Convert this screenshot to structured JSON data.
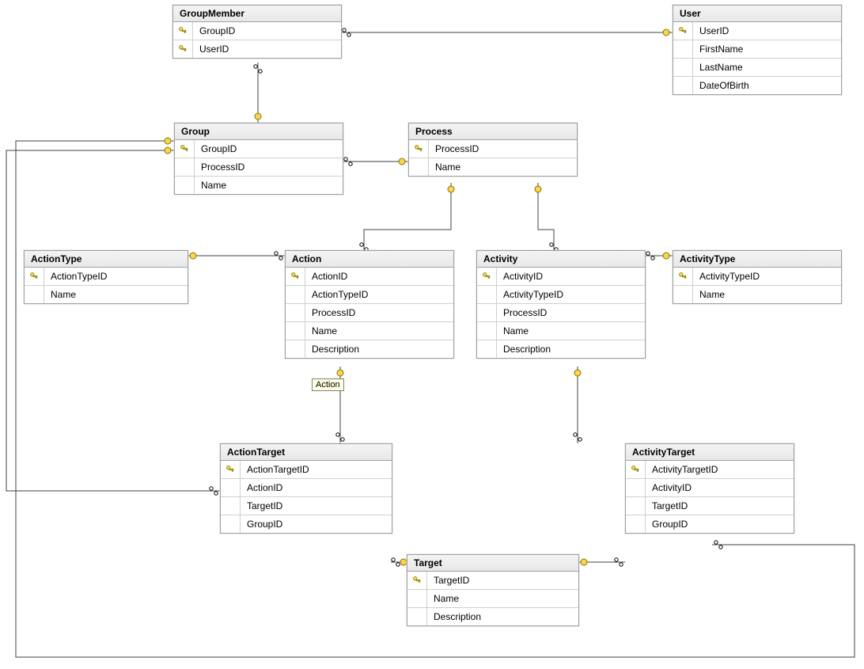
{
  "tooltip": {
    "text": "Action"
  },
  "entities": {
    "GroupMember": {
      "title": "GroupMember",
      "fields": [
        {
          "name": "GroupID",
          "pk": true
        },
        {
          "name": "UserID",
          "pk": true
        }
      ]
    },
    "User": {
      "title": "User",
      "fields": [
        {
          "name": "UserID",
          "pk": true
        },
        {
          "name": "FirstName",
          "pk": false
        },
        {
          "name": "LastName",
          "pk": false
        },
        {
          "name": "DateOfBirth",
          "pk": false
        }
      ]
    },
    "Group": {
      "title": "Group",
      "fields": [
        {
          "name": "GroupID",
          "pk": true
        },
        {
          "name": "ProcessID",
          "pk": false
        },
        {
          "name": "Name",
          "pk": false
        }
      ]
    },
    "Process": {
      "title": "Process",
      "fields": [
        {
          "name": "ProcessID",
          "pk": true
        },
        {
          "name": "Name",
          "pk": false
        }
      ]
    },
    "ActionType": {
      "title": "ActionType",
      "fields": [
        {
          "name": "ActionTypeID",
          "pk": true
        },
        {
          "name": "Name",
          "pk": false
        }
      ]
    },
    "Action": {
      "title": "Action",
      "fields": [
        {
          "name": "ActionID",
          "pk": true
        },
        {
          "name": "ActionTypeID",
          "pk": false
        },
        {
          "name": "ProcessID",
          "pk": false
        },
        {
          "name": "Name",
          "pk": false
        },
        {
          "name": "Description",
          "pk": false
        }
      ]
    },
    "Activity": {
      "title": "Activity",
      "fields": [
        {
          "name": "ActivityID",
          "pk": true
        },
        {
          "name": "ActivityTypeID",
          "pk": false
        },
        {
          "name": "ProcessID",
          "pk": false
        },
        {
          "name": "Name",
          "pk": false
        },
        {
          "name": "Description",
          "pk": false
        }
      ]
    },
    "ActivityType": {
      "title": "ActivityType",
      "fields": [
        {
          "name": "ActivityTypeID",
          "pk": true
        },
        {
          "name": "Name",
          "pk": false
        }
      ]
    },
    "ActionTarget": {
      "title": "ActionTarget",
      "fields": [
        {
          "name": "ActionTargetID",
          "pk": true
        },
        {
          "name": "ActionID",
          "pk": false
        },
        {
          "name": "TargetID",
          "pk": false
        },
        {
          "name": "GroupID",
          "pk": false
        }
      ]
    },
    "ActivityTarget": {
      "title": "ActivityTarget",
      "fields": [
        {
          "name": "ActivityTargetID",
          "pk": true
        },
        {
          "name": "ActivityID",
          "pk": false
        },
        {
          "name": "TargetID",
          "pk": false
        },
        {
          "name": "GroupID",
          "pk": false
        }
      ]
    },
    "Target": {
      "title": "Target",
      "fields": [
        {
          "name": "TargetID",
          "pk": true
        },
        {
          "name": "Name",
          "pk": false
        },
        {
          "name": "Description",
          "pk": false
        }
      ]
    }
  },
  "relationships": [
    {
      "from": "GroupMember",
      "to": "User"
    },
    {
      "from": "GroupMember",
      "to": "Group"
    },
    {
      "from": "Group",
      "to": "Process"
    },
    {
      "from": "Action",
      "to": "ActionType"
    },
    {
      "from": "Action",
      "to": "Process"
    },
    {
      "from": "Activity",
      "to": "Process"
    },
    {
      "from": "Activity",
      "to": "ActivityType"
    },
    {
      "from": "ActionTarget",
      "to": "Action"
    },
    {
      "from": "ActionTarget",
      "to": "Target"
    },
    {
      "from": "ActionTarget",
      "to": "Group"
    },
    {
      "from": "ActivityTarget",
      "to": "Activity"
    },
    {
      "from": "ActivityTarget",
      "to": "Target"
    },
    {
      "from": "ActivityTarget",
      "to": "Group"
    }
  ]
}
